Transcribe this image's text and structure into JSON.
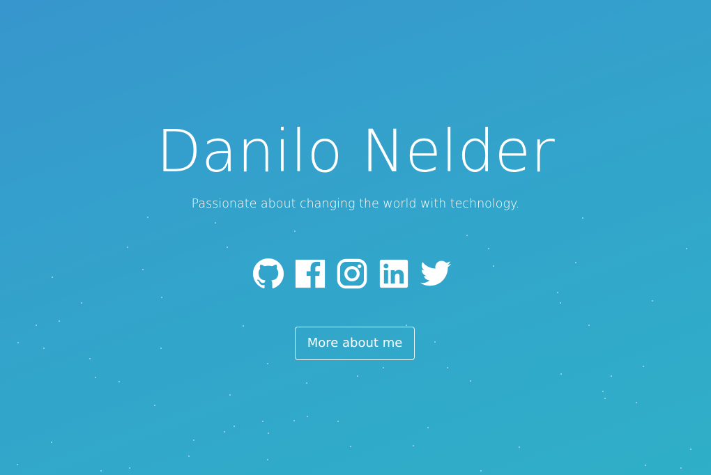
{
  "hero": {
    "name": "Danilo Nelder",
    "tagline": "Passionate about changing the world with technology."
  },
  "social_links": [
    {
      "icon": "github-icon",
      "label": "GitHub"
    },
    {
      "icon": "facebook-icon",
      "label": "Facebook"
    },
    {
      "icon": "instagram-icon",
      "label": "Instagram"
    },
    {
      "icon": "linkedin-icon",
      "label": "LinkedIn"
    },
    {
      "icon": "twitter-icon",
      "label": "Twitter"
    }
  ],
  "cta": {
    "label": "More about me"
  },
  "colors": {
    "background_start": "#3796cd",
    "background_end": "#2fafc8",
    "foreground": "#ffffff"
  }
}
